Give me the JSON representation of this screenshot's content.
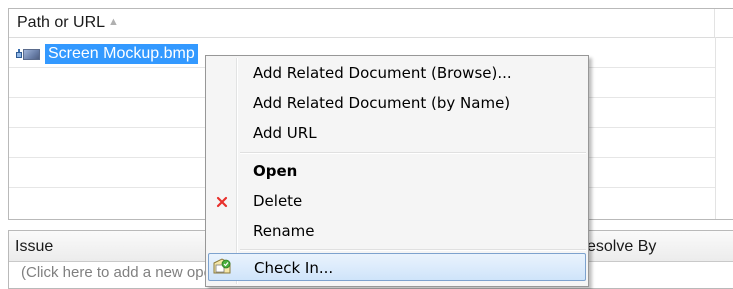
{
  "documents_grid": {
    "column_header": "Path or URL",
    "sort_indicator": "▲",
    "rows": [
      {
        "name": "Screen Mockup.bmp",
        "icon": "image-file-icon"
      }
    ]
  },
  "issues_grid": {
    "column_issue": "Issue",
    "column_resolve_by": "esolve By",
    "add_row_text": "(Click here to add a new open issue)"
  },
  "context_menu": {
    "items": [
      {
        "label": "Add Related Document (Browse)...",
        "bold": false,
        "icon": ""
      },
      {
        "label": "Add Related Document (by Name)",
        "bold": false,
        "icon": ""
      },
      {
        "label": "Add URL",
        "bold": false,
        "icon": ""
      },
      {
        "label": "Open",
        "bold": true,
        "icon": ""
      },
      {
        "label": "Delete",
        "bold": false,
        "icon": "delete-x-icon"
      },
      {
        "label": "Rename",
        "bold": false,
        "icon": ""
      },
      {
        "label": "Check In...",
        "bold": false,
        "icon": "check-in-icon",
        "highlighted": true
      }
    ]
  },
  "colors": {
    "selection": "#3399ff",
    "menu_highlight_border": "#7da2ce",
    "delete_icon": "#e8312c"
  }
}
